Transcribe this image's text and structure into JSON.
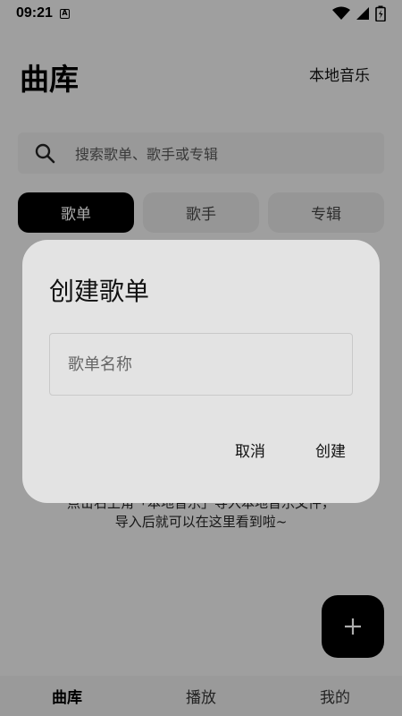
{
  "status_bar": {
    "time": "09:21",
    "a_badge": "A",
    "icons": [
      "wifi-icon",
      "signal-icon",
      "battery-icon"
    ]
  },
  "header": {
    "title": "曲库",
    "local_music": "本地音乐"
  },
  "search": {
    "placeholder": "搜索歌单、歌手或专辑"
  },
  "tabs": [
    {
      "label": "歌单",
      "active": true
    },
    {
      "label": "歌手",
      "active": false
    },
    {
      "label": "专辑",
      "active": false
    }
  ],
  "empty_state": {
    "line1": "点击右上角「本地音乐」导入本地音乐文件，",
    "line2": "导入后就可以在这里看到啦~"
  },
  "fab": {
    "icon": "plus-icon"
  },
  "bottom_nav": [
    {
      "label": "曲库",
      "active": true
    },
    {
      "label": "播放",
      "active": false
    },
    {
      "label": "我的",
      "active": false
    }
  ],
  "dialog": {
    "title": "创建歌单",
    "input_placeholder": "歌单名称",
    "input_value": "",
    "cancel_label": "取消",
    "confirm_label": "创建"
  },
  "colors": {
    "accent": "#000000",
    "background": "#ebebeb",
    "dialog_bg": "#e3e3e3",
    "scrim": "#000000"
  }
}
